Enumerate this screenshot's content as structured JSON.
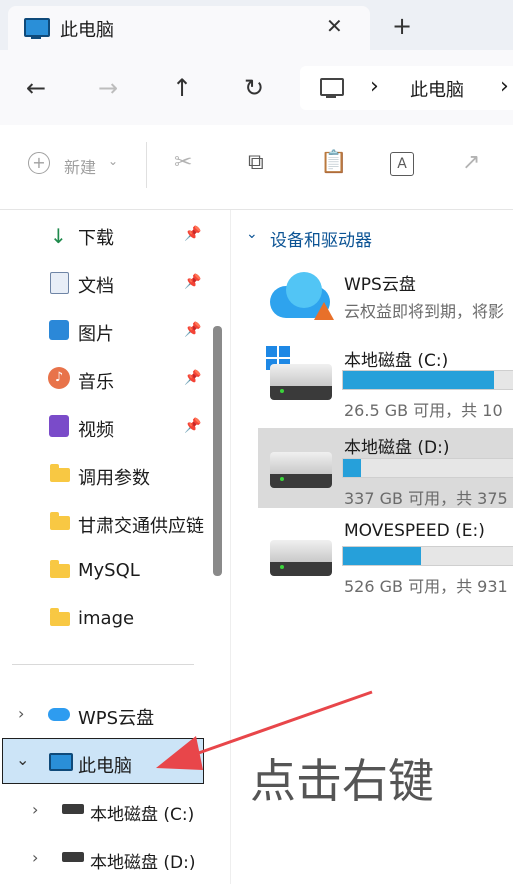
{
  "window": {
    "tab_title": "此电脑",
    "close_glyph": "✕",
    "new_tab_glyph": "+"
  },
  "nav": {
    "back": "←",
    "forward": "→",
    "up": "↑",
    "refresh": "↻",
    "chevron": "›",
    "address_crumb": "此电脑"
  },
  "toolbar": {
    "new_label": "新建"
  },
  "sidebar": {
    "pinned": [
      {
        "label": "下载",
        "icon": "download-icon"
      },
      {
        "label": "文档",
        "icon": "documents-icon"
      },
      {
        "label": "图片",
        "icon": "pictures-icon"
      },
      {
        "label": "音乐",
        "icon": "music-icon"
      },
      {
        "label": "视频",
        "icon": "videos-icon"
      }
    ],
    "folders": [
      "调用参数",
      "甘肃交通供应链",
      "MySQL",
      "image"
    ],
    "wps_cloud": "WPS云盘",
    "this_pc": "此电脑",
    "drive_c": "本地磁盘 (C:)",
    "drive_d": "本地磁盘 (D:)"
  },
  "main": {
    "section_title": "设备和驱动器",
    "wps": {
      "name": "WPS云盘",
      "sub": "云权益即将到期，将影"
    },
    "drives": [
      {
        "name": "本地磁盘 (C:)",
        "sub": "26.5 GB 可用，共 10",
        "used_fraction": 0.85
      },
      {
        "name": "本地磁盘 (D:)",
        "sub": "337 GB 可用，共 375",
        "used_fraction": 0.1
      },
      {
        "name": "MOVESPEED (E:)",
        "sub": "526 GB 可用，共 931",
        "used_fraction": 0.44
      }
    ]
  },
  "annotation": {
    "text": "点击右键",
    "arrow_color": "#e8464a"
  },
  "colors": {
    "accent": "#26a0da",
    "selection": "#cce4f7"
  }
}
